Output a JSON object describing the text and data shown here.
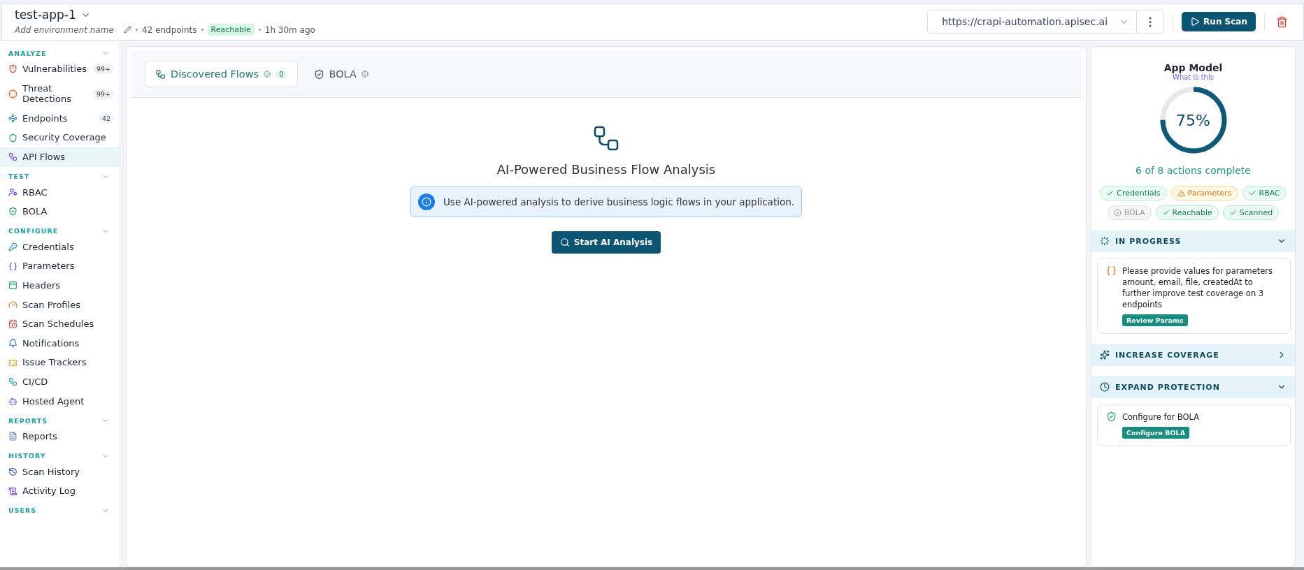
{
  "header": {
    "title": "test-app-1",
    "environment": {
      "placeholder": "Add environment name"
    },
    "endpoints": "42 endpoints",
    "status": "Reachable",
    "last_scan": "1h 30m ago",
    "url": "https://crapi-automation.apisec.ai",
    "run_button": "Run Scan"
  },
  "sidebar": [
    {
      "label": "ANALYZE",
      "expanded": true,
      "items": [
        {
          "label": "Vulnerabilities",
          "count": "99+",
          "selected": false
        },
        {
          "label": "Threat Detections",
          "count": "99+",
          "selected": false
        },
        {
          "label": "Endpoints",
          "count": "42",
          "selected": false
        },
        {
          "label": "Security Coverage",
          "selected": false
        },
        {
          "label": "API Flows",
          "selected": true
        }
      ]
    },
    {
      "label": "TEST",
      "expanded": true,
      "items": [
        {
          "label": "RBAC",
          "selected": false
        },
        {
          "label": "BOLA",
          "selected": false
        }
      ]
    },
    {
      "label": "CONFIGURE",
      "expanded": true,
      "items": [
        {
          "label": "Credentials",
          "selected": false
        },
        {
          "label": "Parameters",
          "selected": false
        },
        {
          "label": "Headers",
          "selected": false
        },
        {
          "label": "Scan Profiles",
          "selected": false
        },
        {
          "label": "Scan Schedules",
          "selected": false
        },
        {
          "label": "Notifications",
          "selected": false
        },
        {
          "label": "Issue Trackers",
          "selected": false
        },
        {
          "label": "CI/CD",
          "selected": false
        },
        {
          "label": "Hosted Agent",
          "selected": false
        }
      ]
    },
    {
      "label": "REPORTS",
      "expanded": true,
      "items": [
        {
          "label": "Reports",
          "selected": false
        }
      ]
    },
    {
      "label": "HISTORY",
      "expanded": true,
      "items": [
        {
          "label": "Scan History",
          "selected": false
        },
        {
          "label": "Activity Log",
          "selected": false
        }
      ]
    },
    {
      "label": "USERS",
      "expanded": true
    }
  ],
  "tabs": [
    {
      "label": "Discovered Flows",
      "count": "0",
      "selected": true
    },
    {
      "label": "BOLA",
      "selected": false
    }
  ],
  "empty_state": {
    "title": "AI-Powered Business Flow Analysis",
    "info": "Use AI-powered analysis to derive business logic flows in your application.",
    "button": "Start AI Analysis"
  },
  "app_model": {
    "title": "App Model",
    "link": "What is this",
    "level": 0.75,
    "percent": "75%",
    "summary": "6 of 8 actions complete",
    "chips": [
      {
        "label": "Credentials",
        "kind": "done"
      },
      {
        "label": "Parameters",
        "kind": "warning"
      },
      {
        "label": "RBAC",
        "kind": "done"
      },
      {
        "label": "BOLA",
        "kind": "missing"
      },
      {
        "label": "Reachable",
        "kind": "done"
      },
      {
        "label": "Scanned",
        "kind": "done"
      }
    ],
    "sections": [
      {
        "title": "IN PROGRESS",
        "expanded": true,
        "cards": [
          {
            "kind": "params",
            "text": "Please provide values for parameters amount, email, file, createdAt to further improve test coverage on 3 endpoints",
            "button": "Review Params"
          }
        ]
      },
      {
        "title": "INCREASE COVERAGE",
        "expanded": false
      },
      {
        "title": "EXPAND PROTECTION",
        "expanded": true,
        "cards": [
          {
            "kind": "protect",
            "text": "Configure for BOLA",
            "button": "Configure BOLA"
          }
        ]
      }
    ]
  }
}
